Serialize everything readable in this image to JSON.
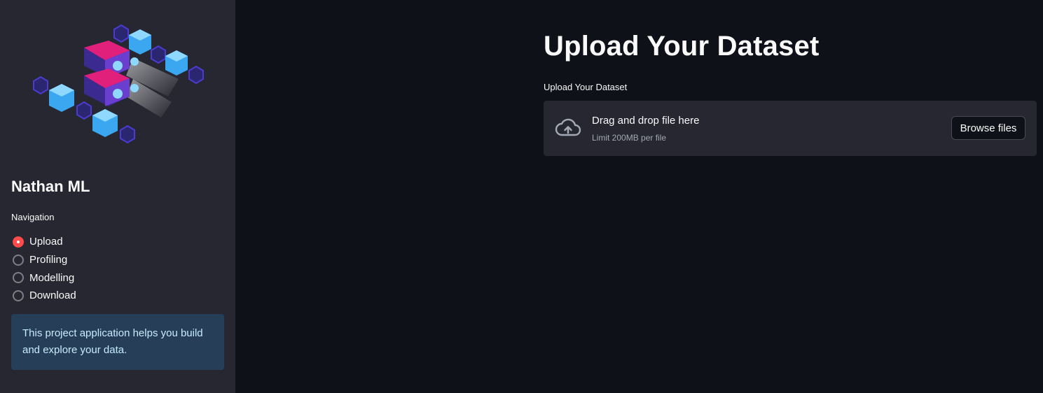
{
  "sidebar": {
    "hero_image": "isometric-server-data-illustration",
    "app_title": "Nathan ML",
    "navigation_label": "Navigation",
    "nav_options": [
      {
        "label": "Upload",
        "selected": true
      },
      {
        "label": "Profiling",
        "selected": false
      },
      {
        "label": "Modelling",
        "selected": false
      },
      {
        "label": "Download",
        "selected": false
      }
    ],
    "info_text": "This project application helps you build and explore your data."
  },
  "main": {
    "title": "Upload Your Dataset",
    "uploader": {
      "label": "Upload Your Dataset",
      "icon": "cloud-upload-icon",
      "instruction": "Drag and drop file here",
      "limit": "Limit 200MB per file",
      "browse_label": "Browse files"
    }
  },
  "colors": {
    "accent": "#ff4b4b",
    "sidebar_bg": "#262730",
    "main_bg": "#0e1117",
    "info_bg": "#273e59",
    "info_text": "#c7ebff"
  }
}
